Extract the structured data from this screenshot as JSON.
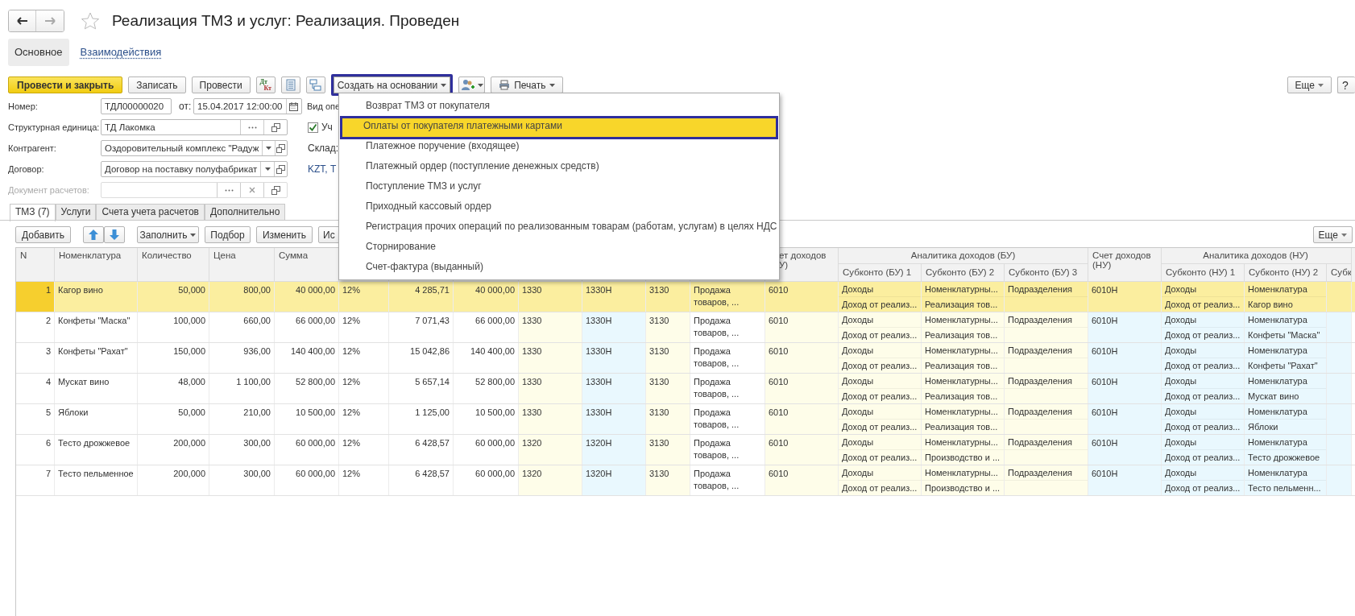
{
  "window": {
    "title": "Реализация ТМЗ и услуг: Реализация. Проведен"
  },
  "sections": [
    {
      "label": "Основное",
      "selected": true
    },
    {
      "label": "Взаимодействия",
      "selected": false
    }
  ],
  "toolbar": {
    "buttons": [
      {
        "kind": "primary",
        "label": "Провести и закрыть"
      },
      {
        "kind": "plain",
        "label": "Записать"
      },
      {
        "kind": "plain",
        "label": "Провести"
      }
    ],
    "dtkt": [
      "Дт",
      "Кт"
    ],
    "create_based": {
      "label": "Создать на основании",
      "highlighted": true
    },
    "print": {
      "label": "Печать"
    },
    "more": {
      "label": "Еще"
    },
    "help": {
      "label": "?"
    }
  },
  "form": {
    "number": {
      "label": "Номер:",
      "value": "ТДЛ00000020"
    },
    "date": {
      "label": "от:",
      "value": "15.04.2017 12:00:00"
    },
    "fields": [
      {
        "label": "Структурная единица:",
        "value": "ТД Лакомка",
        "kind": "choice",
        "disabled": false
      },
      {
        "label": "Контрагент:",
        "value": "Оздоровительный комплекс \"Радуж",
        "kind": "dropdown",
        "disabled": false
      },
      {
        "label": "Договор:",
        "value": "Договор на поставку полуфабрикат",
        "kind": "dropdown",
        "disabled": false
      },
      {
        "label": "Документ расчетов:",
        "kind": "clearable",
        "disabled": true
      }
    ],
    "operation_label": "Вид опе",
    "checkbox": {
      "label": "Уч",
      "checked": true
    },
    "warehouse_label": "Склад:",
    "currency_link": "KZT, Т"
  },
  "doc_tabs": [
    {
      "label": "ТМЗ (7)",
      "selected": true
    },
    {
      "label": "Услуги",
      "selected": false
    },
    {
      "label": "Счета учета расчетов",
      "selected": false
    },
    {
      "label": "Дополнительно",
      "selected": false
    }
  ],
  "table_toolbar": {
    "add": "Добавить",
    "fill": "Заполнить",
    "pick": "Подбор",
    "edit": "Изменить",
    "cut": "Ис",
    "more": "Еще"
  },
  "menu": [
    {
      "label": "Возврат ТМЗ от покупателя",
      "selected": false
    },
    {
      "label": "Оплаты от покупателя платежными картами",
      "selected": true
    },
    {
      "label": "Платежное поручение (входящее)",
      "selected": false
    },
    {
      "label": "Платежный ордер (поступление денежных средств)",
      "selected": false
    },
    {
      "label": "Поступление ТМЗ и услуг",
      "selected": false
    },
    {
      "label": "Приходный кассовый ордер",
      "selected": false
    },
    {
      "label": "Регистрация прочих операций по реализованным товарам (работам, услугам) в целях НДС",
      "selected": false
    },
    {
      "label": "Сторнирование",
      "selected": false
    },
    {
      "label": "Счет-фактура (выданный)",
      "selected": false
    }
  ],
  "table": {
    "columns": [
      {
        "header": "N",
        "color": "#ffffff"
      },
      {
        "header": "Номенклатура",
        "color": "#ffffff"
      },
      {
        "header": "Количество",
        "color": "#ffffff"
      },
      {
        "header": "Цена",
        "color": "#ffffff"
      },
      {
        "header": "Сумма",
        "color": "#ffffff"
      },
      {
        "color": "#ffffff"
      },
      {
        "color": "#ffffff"
      },
      {
        "color": "#ffffff"
      },
      {
        "color": "#fefde9"
      },
      {
        "color": "#e9f8fe"
      },
      {
        "color": "#fefde9"
      },
      {
        "color": "#ffffff"
      },
      {
        "header": "ет доходов\nУ)",
        "color": "#fefde9"
      },
      {
        "group": "Аналитика доходов (БУ)",
        "header": "Субконто (БУ) 1",
        "color": "#fefde9"
      },
      {
        "grouped": true,
        "header": "Субконто (БУ) 2",
        "color": "#fefde9"
      },
      {
        "grouped": true,
        "header": "Субконто (БУ) 3",
        "color": "#fefde9"
      },
      {
        "header": "Счет доходов (НУ)",
        "color": "#e9f8fe"
      },
      {
        "group": "Аналитика доходов (НУ)",
        "header": "Субконто (НУ) 1",
        "color": "#e9f8fe"
      },
      {
        "grouped": true,
        "header": "Субконто (НУ) 2",
        "color": "#e9f8fe"
      },
      {
        "grouped": true,
        "header": "Субк",
        "color": "#e9f8fe"
      }
    ],
    "rows": [
      {
        "selected": true,
        "cells": [
          "1",
          "Кагор вино",
          "50,000",
          "800,00",
          "40 000,00",
          "12%",
          "4 285,71",
          "40 000,00",
          "1330",
          "1330Н",
          "3130",
          "Продажа товаров, ...",
          "6010",
          [
            "Доходы",
            "Доход от реализ..."
          ],
          [
            "Номенклатурны...",
            "Реализация тов..."
          ],
          [
            "Подразделения"
          ],
          "6010Н",
          [
            "Доходы",
            "Доход от реализ..."
          ],
          [
            "Номенклатура",
            "Кагор вино"
          ]
        ]
      },
      {
        "selected": false,
        "cells": [
          "2",
          "Конфеты \"Маска\"",
          "100,000",
          "660,00",
          "66 000,00",
          "12%",
          "7 071,43",
          "66 000,00",
          "1330",
          "1330Н",
          "3130",
          "Продажа товаров, ...",
          "6010",
          [
            "Доходы",
            "Доход от реализ..."
          ],
          [
            "Номенклатурны...",
            "Реализация тов..."
          ],
          [
            "Подразделения"
          ],
          "6010Н",
          [
            "Доходы",
            "Доход от реализ..."
          ],
          [
            "Номенклатура",
            "Конфеты \"Маска\""
          ]
        ]
      },
      {
        "selected": false,
        "cells": [
          "3",
          "Конфеты \"Рахат\"",
          "150,000",
          "936,00",
          "140 400,00",
          "12%",
          "15 042,86",
          "140 400,00",
          "1330",
          "1330Н",
          "3130",
          "Продажа товаров, ...",
          "6010",
          [
            "Доходы",
            "Доход от реализ..."
          ],
          [
            "Номенклатурны...",
            "Реализация тов..."
          ],
          [
            "Подразделения"
          ],
          "6010Н",
          [
            "Доходы",
            "Доход от реализ..."
          ],
          [
            "Номенклатура",
            "Конфеты \"Рахат\""
          ]
        ]
      },
      {
        "selected": false,
        "cells": [
          "4",
          "Мускат вино",
          "48,000",
          "1 100,00",
          "52 800,00",
          "12%",
          "5 657,14",
          "52 800,00",
          "1330",
          "1330Н",
          "3130",
          "Продажа товаров, ...",
          "6010",
          [
            "Доходы",
            "Доход от реализ..."
          ],
          [
            "Номенклатурны...",
            "Реализация тов..."
          ],
          [
            "Подразделения"
          ],
          "6010Н",
          [
            "Доходы",
            "Доход от реализ..."
          ],
          [
            "Номенклатура",
            "Мускат вино"
          ]
        ]
      },
      {
        "selected": false,
        "cells": [
          "5",
          "Яблоки",
          "50,000",
          "210,00",
          "10 500,00",
          "12%",
          "1 125,00",
          "10 500,00",
          "1330",
          "1330Н",
          "3130",
          "Продажа товаров, ...",
          "6010",
          [
            "Доходы",
            "Доход от реализ..."
          ],
          [
            "Номенклатурны...",
            "Реализация тов..."
          ],
          [
            "Подразделения"
          ],
          "6010Н",
          [
            "Доходы",
            "Доход от реализ..."
          ],
          [
            "Номенклатура",
            "Яблоки"
          ]
        ]
      },
      {
        "selected": false,
        "cells": [
          "6",
          "Тесто дрожжевое",
          "200,000",
          "300,00",
          "60 000,00",
          "12%",
          "6 428,57",
          "60 000,00",
          "1320",
          "1320Н",
          "3130",
          "Продажа товаров, ...",
          "6010",
          [
            "Доходы",
            "Доход от реализ..."
          ],
          [
            "Номенклатурны...",
            "Производство и ..."
          ],
          [
            "Подразделения"
          ],
          "6010Н",
          [
            "Доходы",
            "Доход от реализ..."
          ],
          [
            "Номенклатура",
            "Тесто дрожжевое"
          ]
        ]
      },
      {
        "selected": false,
        "cells": [
          "7",
          "Тесто пельменное",
          "200,000",
          "300,00",
          "60 000,00",
          "12%",
          "6 428,57",
          "60 000,00",
          "1320",
          "1320Н",
          "3130",
          "Продажа товаров, ...",
          "6010",
          [
            "Доходы",
            "Доход от реализ..."
          ],
          [
            "Номенклатурны...",
            "Производство и ..."
          ],
          [
            "Подразделения"
          ],
          "6010Н",
          [
            "Доходы",
            "Доход от реализ..."
          ],
          [
            "Номенклатура",
            "Тесто пельменн..."
          ]
        ]
      }
    ]
  }
}
